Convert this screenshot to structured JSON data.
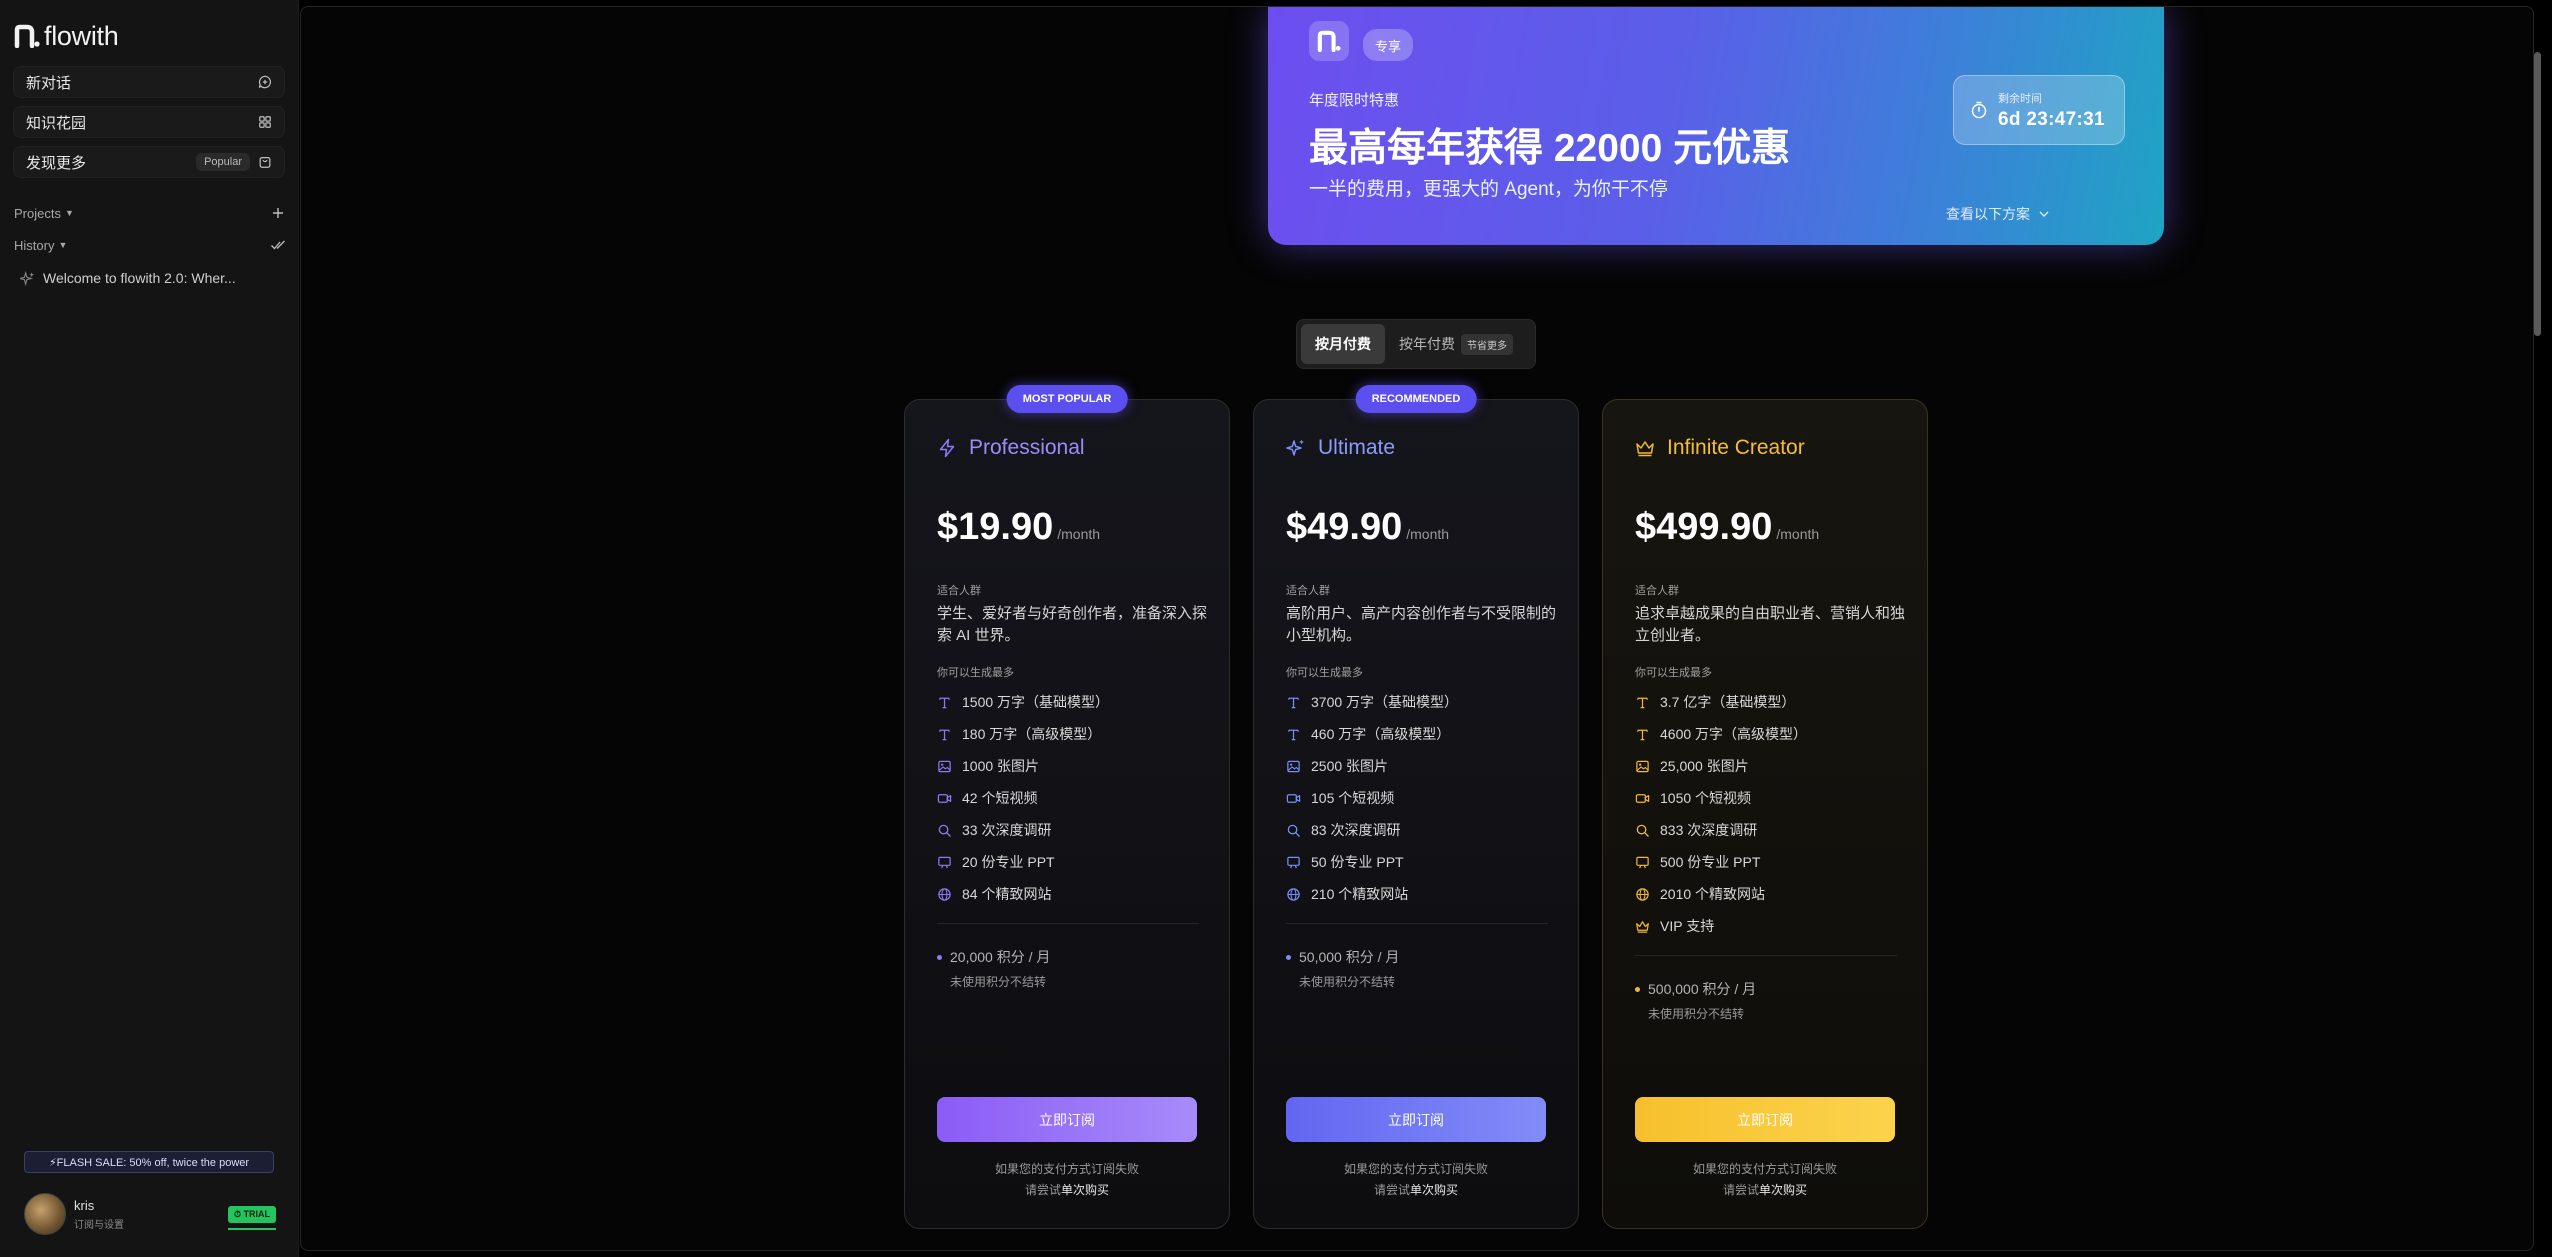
{
  "app": {
    "name": "flowith"
  },
  "sidebar": {
    "nav": [
      {
        "label": "新对话",
        "icon": "chat-plus-icon"
      },
      {
        "label": "知识花园",
        "icon": "grid-icon"
      },
      {
        "label": "发现更多",
        "badge": "Popular",
        "icon": "bag-icon"
      }
    ],
    "projects_label": "Projects",
    "history_label": "History",
    "history_items": [
      "Welcome to flowith 2.0: Wher..."
    ],
    "flash_sale": "⚡FLASH SALE: 50% off, twice the power",
    "user": {
      "name": "kris",
      "subtitle": "订阅与设置",
      "badge": "⏱ TRIAL"
    }
  },
  "promo": {
    "tag": "专享",
    "eyebrow": "年度限时特惠",
    "title": "最高每年获得 22000 元优惠",
    "subtitle": "一半的费用，更强大的 Agent，为你干不停",
    "countdown_label": "剩余时间",
    "countdown_value": "6d 23:47:31",
    "link": "查看以下方案"
  },
  "billing": {
    "monthly": "按月付费",
    "yearly": "按年付费",
    "yearly_badge": "节省更多",
    "selected": "monthly"
  },
  "colors": {
    "professional": "#8b7cf6",
    "ultimate": "#7c8cf8",
    "infinite": "#f4b92d"
  },
  "plans": [
    {
      "badge": "MOST POPULAR",
      "name": "Professional",
      "icon": "bolt-icon",
      "price": "$19.90",
      "per": "/month",
      "audience_label": "适合人群",
      "audience": "学生、爱好者与好奇创作者，准备深入探索 AI 世界。",
      "features_label": "你可以生成最多",
      "features": [
        {
          "icon": "text-icon",
          "text": "1500 万字（基础模型）"
        },
        {
          "icon": "text-icon",
          "text": "180 万字（高级模型）"
        },
        {
          "icon": "image-icon",
          "text": "1000 张图片"
        },
        {
          "icon": "video-icon",
          "text": "42 个短视频"
        },
        {
          "icon": "search-icon",
          "text": "33 次深度调研"
        },
        {
          "icon": "slides-icon",
          "text": "20 份专业 PPT"
        },
        {
          "icon": "globe-icon",
          "text": "84 个精致网站"
        }
      ],
      "credits": "20,000 积分 / 月",
      "credits_note": "未使用积分不结转",
      "cta": "立即订阅",
      "note_line1": "如果您的支付方式订阅失败",
      "note_prefix": "请尝试",
      "note_link": "单次购买"
    },
    {
      "badge": "RECOMMENDED",
      "name": "Ultimate",
      "icon": "sparkle-icon",
      "price": "$49.90",
      "per": "/month",
      "audience_label": "适合人群",
      "audience": "高阶用户、高产内容创作者与不受限制的小型机构。",
      "features_label": "你可以生成最多",
      "features": [
        {
          "icon": "text-icon",
          "text": "3700 万字（基础模型）"
        },
        {
          "icon": "text-icon",
          "text": "460 万字（高级模型）"
        },
        {
          "icon": "image-icon",
          "text": "2500 张图片"
        },
        {
          "icon": "video-icon",
          "text": "105 个短视频"
        },
        {
          "icon": "search-icon",
          "text": "83 次深度调研"
        },
        {
          "icon": "slides-icon",
          "text": "50 份专业 PPT"
        },
        {
          "icon": "globe-icon",
          "text": "210 个精致网站"
        }
      ],
      "credits": "50,000 积分 / 月",
      "credits_note": "未使用积分不结转",
      "cta": "立即订阅",
      "note_line1": "如果您的支付方式订阅失败",
      "note_prefix": "请尝试",
      "note_link": "单次购买"
    },
    {
      "badge": "",
      "name": "Infinite Creator",
      "icon": "crown-icon",
      "price": "$499.90",
      "per": "/month",
      "audience_label": "适合人群",
      "audience": "追求卓越成果的自由职业者、营销人和独立创业者。",
      "features_label": "你可以生成最多",
      "features": [
        {
          "icon": "text-icon",
          "text": "3.7 亿字（基础模型）"
        },
        {
          "icon": "text-icon",
          "text": "4600 万字（高级模型）"
        },
        {
          "icon": "image-icon",
          "text": "25,000 张图片"
        },
        {
          "icon": "video-icon",
          "text": "1050 个短视频"
        },
        {
          "icon": "search-icon",
          "text": "833 次深度调研"
        },
        {
          "icon": "slides-icon",
          "text": "500 份专业 PPT"
        },
        {
          "icon": "globe-icon",
          "text": "2010 个精致网站"
        },
        {
          "icon": "crown-icon",
          "text": "VIP 支持"
        }
      ],
      "credits": "500,000 积分 / 月",
      "credits_note": "未使用积分不结转",
      "cta": "立即订阅",
      "note_line1": "如果您的支付方式订阅失败",
      "note_prefix": "请尝试",
      "note_link": "单次购买"
    }
  ]
}
